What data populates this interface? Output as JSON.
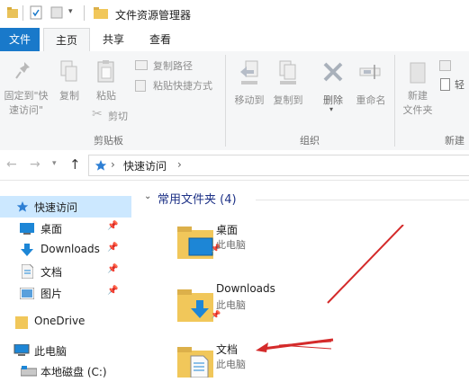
{
  "window": {
    "title": "文件资源管理器"
  },
  "tabs": {
    "file": "文件",
    "home": "主页",
    "share": "共享",
    "view": "查看"
  },
  "ribbon": {
    "clipboard": {
      "pin_quick_access": [
        "固定到\"快",
        "速访问\""
      ],
      "copy": "复制",
      "paste": "粘贴",
      "copy_path": "复制路径",
      "paste_shortcut": "粘贴快捷方式",
      "cut": "剪切",
      "group_label": "剪贴板"
    },
    "organize": {
      "move_to": "移动到",
      "copy_to": "复制到",
      "delete": "删除",
      "rename": "重命名",
      "group_label": "组织"
    },
    "new": {
      "new_folder": [
        "新建",
        "文件夹"
      ],
      "easy_access": "轻",
      "group_label": "新建"
    }
  },
  "address": {
    "crumb": "快速访问",
    "separator": "›"
  },
  "nav": {
    "items": [
      {
        "label": "快速访问",
        "pinned": false
      },
      {
        "label": "桌面",
        "pinned": true
      },
      {
        "label": "Downloads",
        "pinned": true
      },
      {
        "label": "文档",
        "pinned": true
      },
      {
        "label": "图片",
        "pinned": true
      },
      {
        "label": "OneDrive",
        "pinned": false
      },
      {
        "label": "此电脑",
        "pinned": false
      },
      {
        "label": "本地磁盘 (C:)",
        "pinned": false
      }
    ]
  },
  "content": {
    "group_title": "常用文件夹 (4)",
    "folders": [
      {
        "name": "桌面",
        "location": "此电脑"
      },
      {
        "name": "Downloads",
        "location": "此电脑"
      },
      {
        "name": "文档",
        "location": "此电脑"
      }
    ]
  },
  "colors": {
    "accent": "#1979ca",
    "annotation_arrow": "#d42a2a",
    "folder": "#f1c75a"
  }
}
